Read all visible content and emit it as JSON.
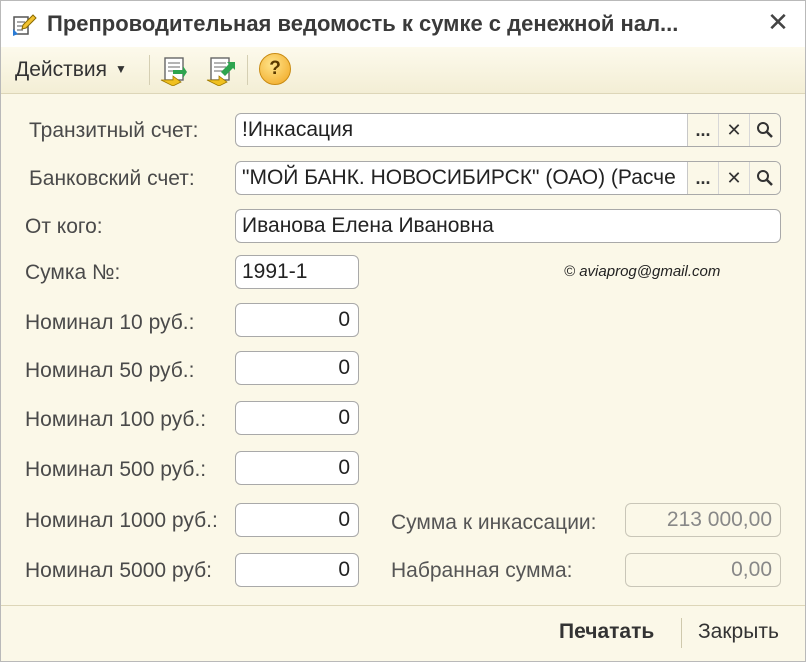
{
  "window": {
    "title": "Препроводительная ведомость к сумке с денежной нал...",
    "title_icon": "document-edit-icon",
    "close_label": "✕"
  },
  "toolbar": {
    "actions_label": "Действия",
    "buttons": [
      "import-green-arrow-icon",
      "export-green-arrow-icon"
    ],
    "help_label": "?"
  },
  "form": {
    "transit_account": {
      "label": "Транзитный счет:",
      "value": "!Инкасация"
    },
    "bank_account": {
      "label": "Банковский счет:",
      "value": "\"МОЙ БАНК. НОВОСИБИРСК\" (ОАО) (Расче"
    },
    "from_whom": {
      "label": "От кого:",
      "value": "Иванова Елена Ивановна"
    },
    "bag_number": {
      "label": "Сумка №:",
      "value": "1991-1"
    },
    "copyright": "© aviaprog@gmail.com",
    "denominations": [
      {
        "label": "Номинал 10 руб.:",
        "value": "0"
      },
      {
        "label": "Номинал 50 руб.:",
        "value": "0"
      },
      {
        "label": "Номинал 100 руб.:",
        "value": "0"
      },
      {
        "label": "Номинал 500 руб.:",
        "value": "0"
      },
      {
        "label": "Номинал 1000 руб.:",
        "value": "0"
      },
      {
        "label": "Номинал 5000 руб:",
        "value": "0"
      }
    ],
    "collection_sum": {
      "label": "Сумма к инкассации:",
      "value": "213 000,00"
    },
    "collected_sum": {
      "label": "Набранная сумма:",
      "value": "0,00"
    },
    "select_button": "...",
    "clear_button": "✕",
    "search_button": "search-icon"
  },
  "footer": {
    "print_label": "Печатать",
    "close_label": "Закрыть"
  }
}
